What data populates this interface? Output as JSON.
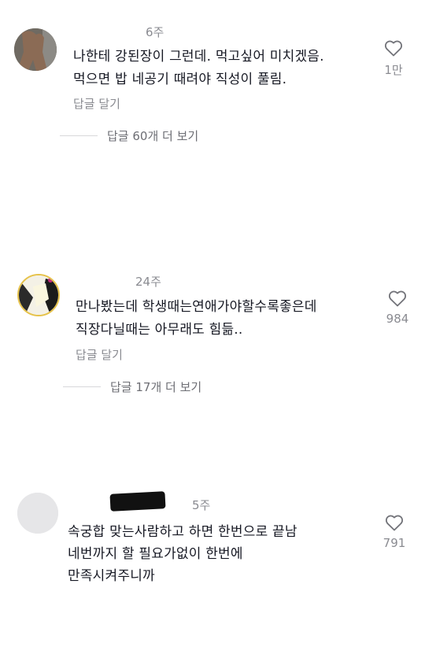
{
  "comments": [
    {
      "meta": "6주",
      "lines": [
        "나한테 강된장이 그런데. 먹고싶어 미치겠음.",
        "먹으면 밥 네공기 때려야 직성이 풀림."
      ],
      "reply_label": "답글 달기",
      "view_replies": "답글 60개 더 보기",
      "likes": "1만"
    },
    {
      "meta": "24주",
      "lines": [
        "만나봤는데 학생때는연애가야할수록좋은데",
        "직장다닐때는 아무래도 힘듦.."
      ],
      "reply_label": "답글 달기",
      "view_replies": "답글 17개 더 보기",
      "likes": "984"
    },
    {
      "meta": "5주",
      "lines": [
        "속궁합 맞는사람하고 하면 한번으로 끝남",
        "네번까지 할 필요가없이  한번에",
        "만족시켜주니까"
      ],
      "likes": "791"
    }
  ]
}
